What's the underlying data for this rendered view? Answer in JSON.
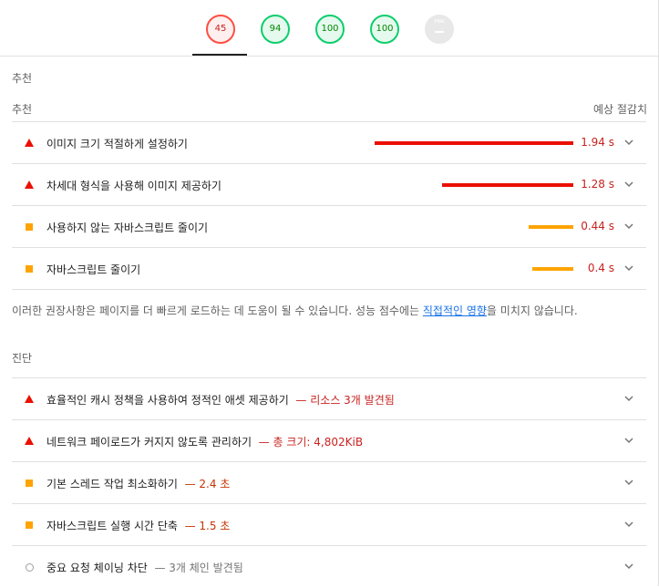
{
  "scores": [
    {
      "value": "45",
      "status": "fail",
      "selected": true
    },
    {
      "value": "94",
      "status": "pass"
    },
    {
      "value": "100",
      "status": "pass"
    },
    {
      "value": "100",
      "status": "pass"
    },
    {
      "value": "PWA",
      "status": "na"
    }
  ],
  "opportunities": {
    "section_title": "추천",
    "col_left": "추천",
    "col_right": "예상 절감치",
    "items": [
      {
        "title": "이미지 크기 적절하게 설정하기",
        "savings": "1.94 s",
        "severity": "fail"
      },
      {
        "title": "차세대 형식을 사용해 이미지 제공하기",
        "savings": "1.28 s",
        "severity": "fail"
      },
      {
        "title": "사용하지 않는 자바스크립트 줄이기",
        "savings": "0.44 s",
        "severity": "average"
      },
      {
        "title": "자바스크립트 줄이기",
        "savings": "0.4 s",
        "severity": "average"
      }
    ],
    "note_before": "이러한 권장사항은 페이지를 더 빠르게 로드하는 데 도움이 될 수 있습니다. 성능 점수에는 ",
    "note_link": "직접적인 영향",
    "note_after": "을 미치지 않습니다."
  },
  "diagnostics": {
    "section_title": "진단",
    "items": [
      {
        "title": "효율적인 캐시 정책을 사용하여 정적인 애셋 제공하기",
        "detail": "— 리소스 3개 발견됨",
        "severity": "fail"
      },
      {
        "title": "네트워크 페이로드가 커지지 않도록 관리하기",
        "detail": "— 총 크기: 4,802KiB",
        "severity": "fail"
      },
      {
        "title": "기본 스레드 작업 최소화하기",
        "detail": "— 2.4 초",
        "severity": "average"
      },
      {
        "title": "자바스크립트 실행 시간 단축",
        "detail": "— 1.5 초",
        "severity": "average"
      },
      {
        "title": "중요 요청 체이닝 차단",
        "detail": "— 3개 체인 발견됨",
        "severity": "info"
      }
    ]
  },
  "colors": {
    "fail": "#eb0f00",
    "average": "#ffa400",
    "pass": "#0cce6b",
    "link": "#1a73e8"
  },
  "icons": [
    "triangle-fail-icon",
    "square-average-icon",
    "circle-info-icon",
    "chevron-down-icon"
  ]
}
